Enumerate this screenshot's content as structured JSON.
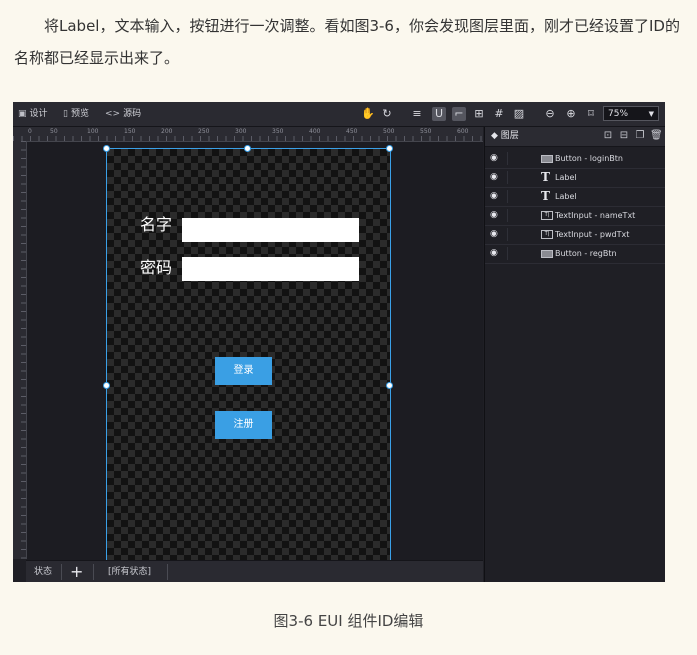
{
  "article": {
    "paragraph": "将Label，文本输入，按钮进行一次调整。看如图3-6，你会发现图层里面，刚才已经设置了ID的名称都已经显示出来了。",
    "caption": "图3-6 EUI 组件ID编辑"
  },
  "toolbar": {
    "design_label": "设计",
    "preview_label": "预览",
    "source_label": "源码",
    "zoom_value": "75%"
  },
  "ruler": {
    "top_labels": [
      "0",
      "50",
      "100",
      "150",
      "200",
      "250",
      "300",
      "350",
      "400",
      "450",
      "500",
      "550",
      "600"
    ]
  },
  "canvas": {
    "name_label": "名字",
    "password_label": "密码",
    "login_button": "登录",
    "register_button": "注册"
  },
  "statusbar": {
    "state_label": "状态",
    "add_label": "+",
    "all_states_label": "[所有状态]"
  },
  "layers_panel": {
    "title": "图层",
    "items": [
      {
        "type": "Button",
        "name": "Button - loginBtn"
      },
      {
        "type": "Label",
        "name": "Label"
      },
      {
        "type": "Label",
        "name": "Label"
      },
      {
        "type": "TextInput",
        "name": "TextInput - nameTxt"
      },
      {
        "type": "TextInput",
        "name": "TextInput - pwdTxt"
      },
      {
        "type": "Button",
        "name": "Button - regBtn"
      }
    ]
  },
  "colors": {
    "accent": "#3a9fe4",
    "page_bg": "#fbf8ee",
    "editor_bg": "#1f1f25"
  }
}
